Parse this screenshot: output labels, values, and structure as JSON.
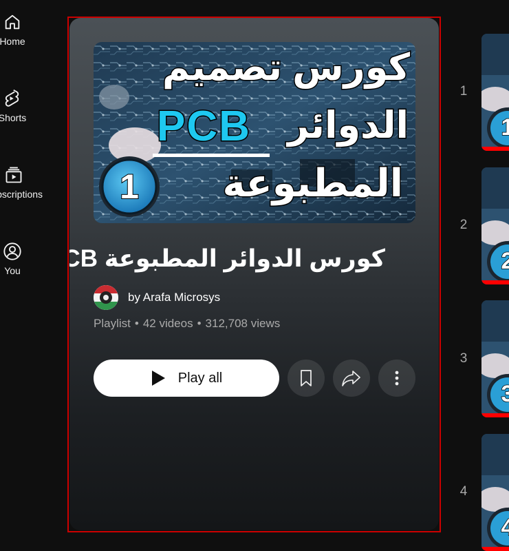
{
  "sidebar": {
    "items": [
      {
        "label": "Home",
        "icon": "home-icon"
      },
      {
        "label": "Shorts",
        "icon": "shorts-icon"
      },
      {
        "label": "Subscriptions",
        "icon": "subscriptions-icon"
      },
      {
        "label": "You",
        "icon": "user-icon"
      }
    ]
  },
  "playlist": {
    "thumbnail_text": {
      "line1": "كورس تصميم",
      "line2_left": "PCB",
      "line2_right": "الدوائر",
      "line3": "المطبوعة",
      "badge": "1"
    },
    "title": "كورس الدوائر المطبوعة PCB",
    "owner": "by Arafa Microsys",
    "type": "Playlist",
    "video_count": "42 videos",
    "views": "312,708 views",
    "play_all_label": "Play all"
  },
  "videos": [
    {
      "index": "1",
      "badge": "1"
    },
    {
      "index": "2",
      "badge": "2"
    },
    {
      "index": "3",
      "badge": "3"
    },
    {
      "index": "4",
      "badge": "4"
    }
  ],
  "colors": {
    "accent": "#cc0000",
    "thumb_pcb_text": "#1ec8f0",
    "badge_blue": "#2a9fd6"
  }
}
